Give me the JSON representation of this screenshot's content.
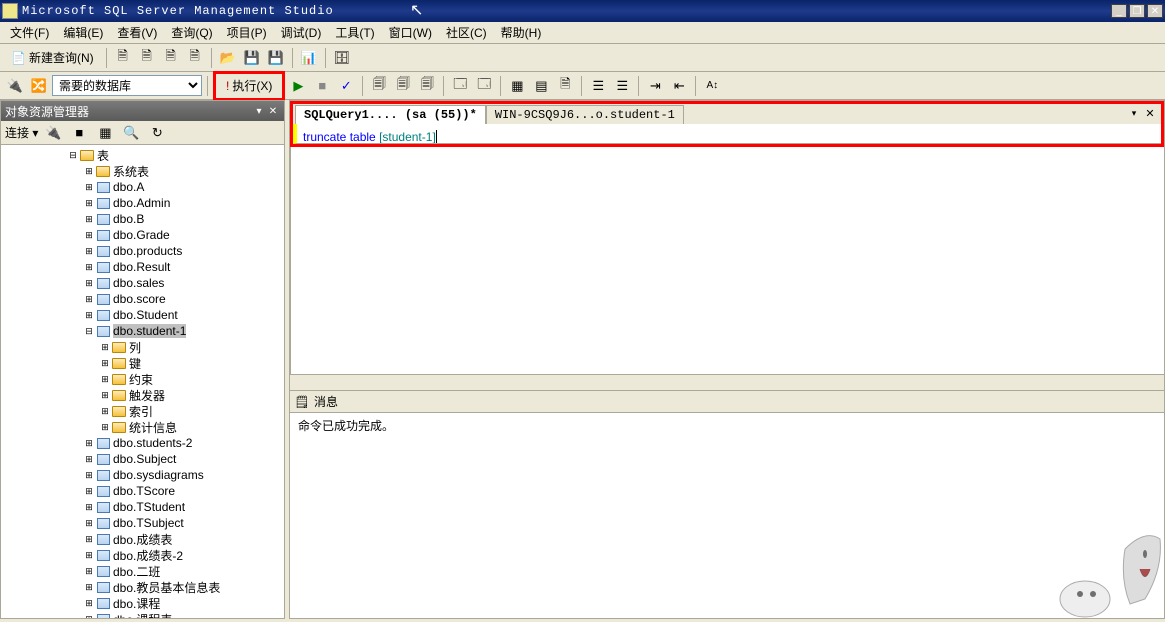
{
  "window": {
    "title": "Microsoft SQL Server Management Studio",
    "minimize": "_",
    "restore": "❐",
    "close": "✕"
  },
  "menu": {
    "file": "文件(F)",
    "edit": "编辑(E)",
    "view": "查看(V)",
    "query": "查询(Q)",
    "project": "项目(P)",
    "debug": "调试(D)",
    "tools": "工具(T)",
    "window": "窗口(W)",
    "community": "社区(C)",
    "help": "帮助(H)"
  },
  "toolbar1": {
    "new_query": "新建查询(N)"
  },
  "toolbar2": {
    "database_combo": "需要的数据库",
    "execute": "执行(X)"
  },
  "object_explorer": {
    "title": "对象资源管理器",
    "connect_label": "连接 ▾",
    "root_folder": "表",
    "nodes": [
      "系统表",
      "dbo.A",
      "dbo.Admin",
      "dbo.B",
      "dbo.Grade",
      "dbo.products",
      "dbo.Result",
      "dbo.sales",
      "dbo.score",
      "dbo.Student"
    ],
    "selected_node": "dbo.student-1",
    "selected_children": [
      "列",
      "键",
      "约束",
      "触发器",
      "索引",
      "统计信息"
    ],
    "nodes_after": [
      "dbo.students-2",
      "dbo.Subject",
      "dbo.sysdiagrams",
      "dbo.TScore",
      "dbo.TStudent",
      "dbo.TSubject",
      "dbo.成绩表",
      "dbo.成绩表-2",
      "dbo.二班",
      "dbo.教员基本信息表",
      "dbo.课程",
      "dbo.课程表"
    ]
  },
  "editor": {
    "tabs": {
      "active": "SQLQuery1.... (sa (55))*",
      "inactive": "WIN-9CSQ9J6...o.student-1"
    },
    "sql_truncate": "truncate",
    "sql_table": " table ",
    "sql_bracket1": "[",
    "sql_tablename": "student-1",
    "sql_bracket2": "]"
  },
  "messages": {
    "tab_label": "消息",
    "content": "命令已成功完成。"
  }
}
